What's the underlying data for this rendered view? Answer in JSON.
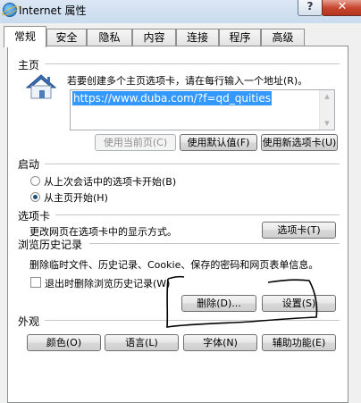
{
  "window": {
    "title": "Internet 属性",
    "help_label": "?",
    "close_label": "✕"
  },
  "tabs": [
    {
      "label": "常规",
      "active": true
    },
    {
      "label": "安全",
      "active": false
    },
    {
      "label": "隐私",
      "active": false
    },
    {
      "label": "内容",
      "active": false
    },
    {
      "label": "连接",
      "active": false
    },
    {
      "label": "程序",
      "active": false
    },
    {
      "label": "高级",
      "active": false
    }
  ],
  "homepage": {
    "section_title": "主页",
    "instruction": "若要创建多个主页选项卡，请在每行输入一个地址(R)。",
    "url": "https://www.duba.com/?f=qd_quities",
    "buttons": {
      "use_current": "使用当前页(C)",
      "use_default": "使用默认值(F)",
      "use_new_tab": "使用新选项卡(U)"
    }
  },
  "startup": {
    "section_title": "启动",
    "option_last_session": "从上次会话中的选项卡开始(B)",
    "option_home_page": "从主页开始(H)",
    "selected": "home_page"
  },
  "tabs_section": {
    "section_title": "选项卡",
    "description": "更改网页在选项卡中的显示方式。",
    "button": "选项卡(T)"
  },
  "history": {
    "section_title": "浏览历史记录",
    "description": "删除临时文件、历史记录、Cookie、保存的密码和网页表单信息。",
    "checkbox_label": "退出时删除浏览历史记录(W)",
    "checkbox_checked": false,
    "delete_button": "删除(D)...",
    "settings_button": "设置(S)"
  },
  "appearance": {
    "section_title": "外观",
    "colors_button": "颜色(O)",
    "languages_button": "语言(L)",
    "fonts_button": "字体(N)",
    "accessibility_button": "辅助功能(E)"
  }
}
